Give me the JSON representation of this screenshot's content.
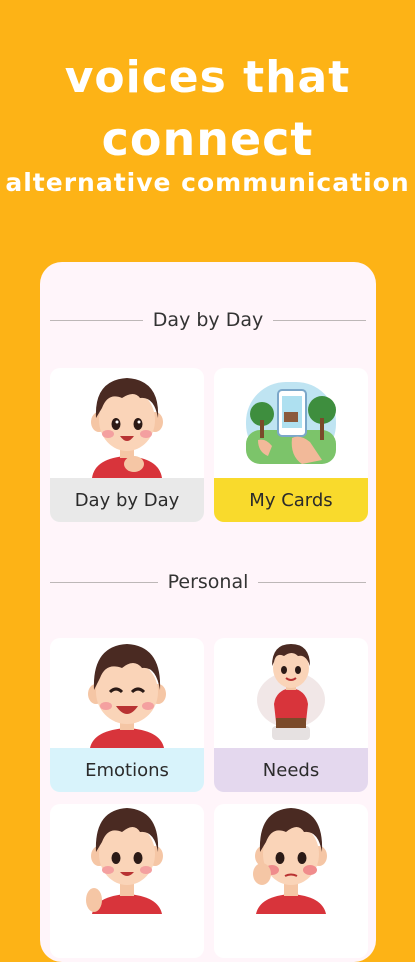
{
  "hero": {
    "line1": "voices that",
    "line2": "connect",
    "subtitle": "alternative communication"
  },
  "sections": [
    {
      "title": "Day by Day",
      "cards": [
        {
          "label": "Day by Day",
          "color": "#E9E9E9",
          "icon": "boy-smiling-icon"
        },
        {
          "label": "My Cards",
          "color": "#F9DA2C",
          "icon": "phone-camera-park-icon"
        }
      ]
    },
    {
      "title": "Personal",
      "cards": [
        {
          "label": "Emotions",
          "color": "#D8F3FB",
          "icon": "boy-laughing-icon"
        },
        {
          "label": "Needs",
          "color": "#E4D8EE",
          "icon": "boy-toilet-icon"
        }
      ]
    }
  ],
  "colors": {
    "background": "#FDB316",
    "phone": "#FFF5FA"
  }
}
